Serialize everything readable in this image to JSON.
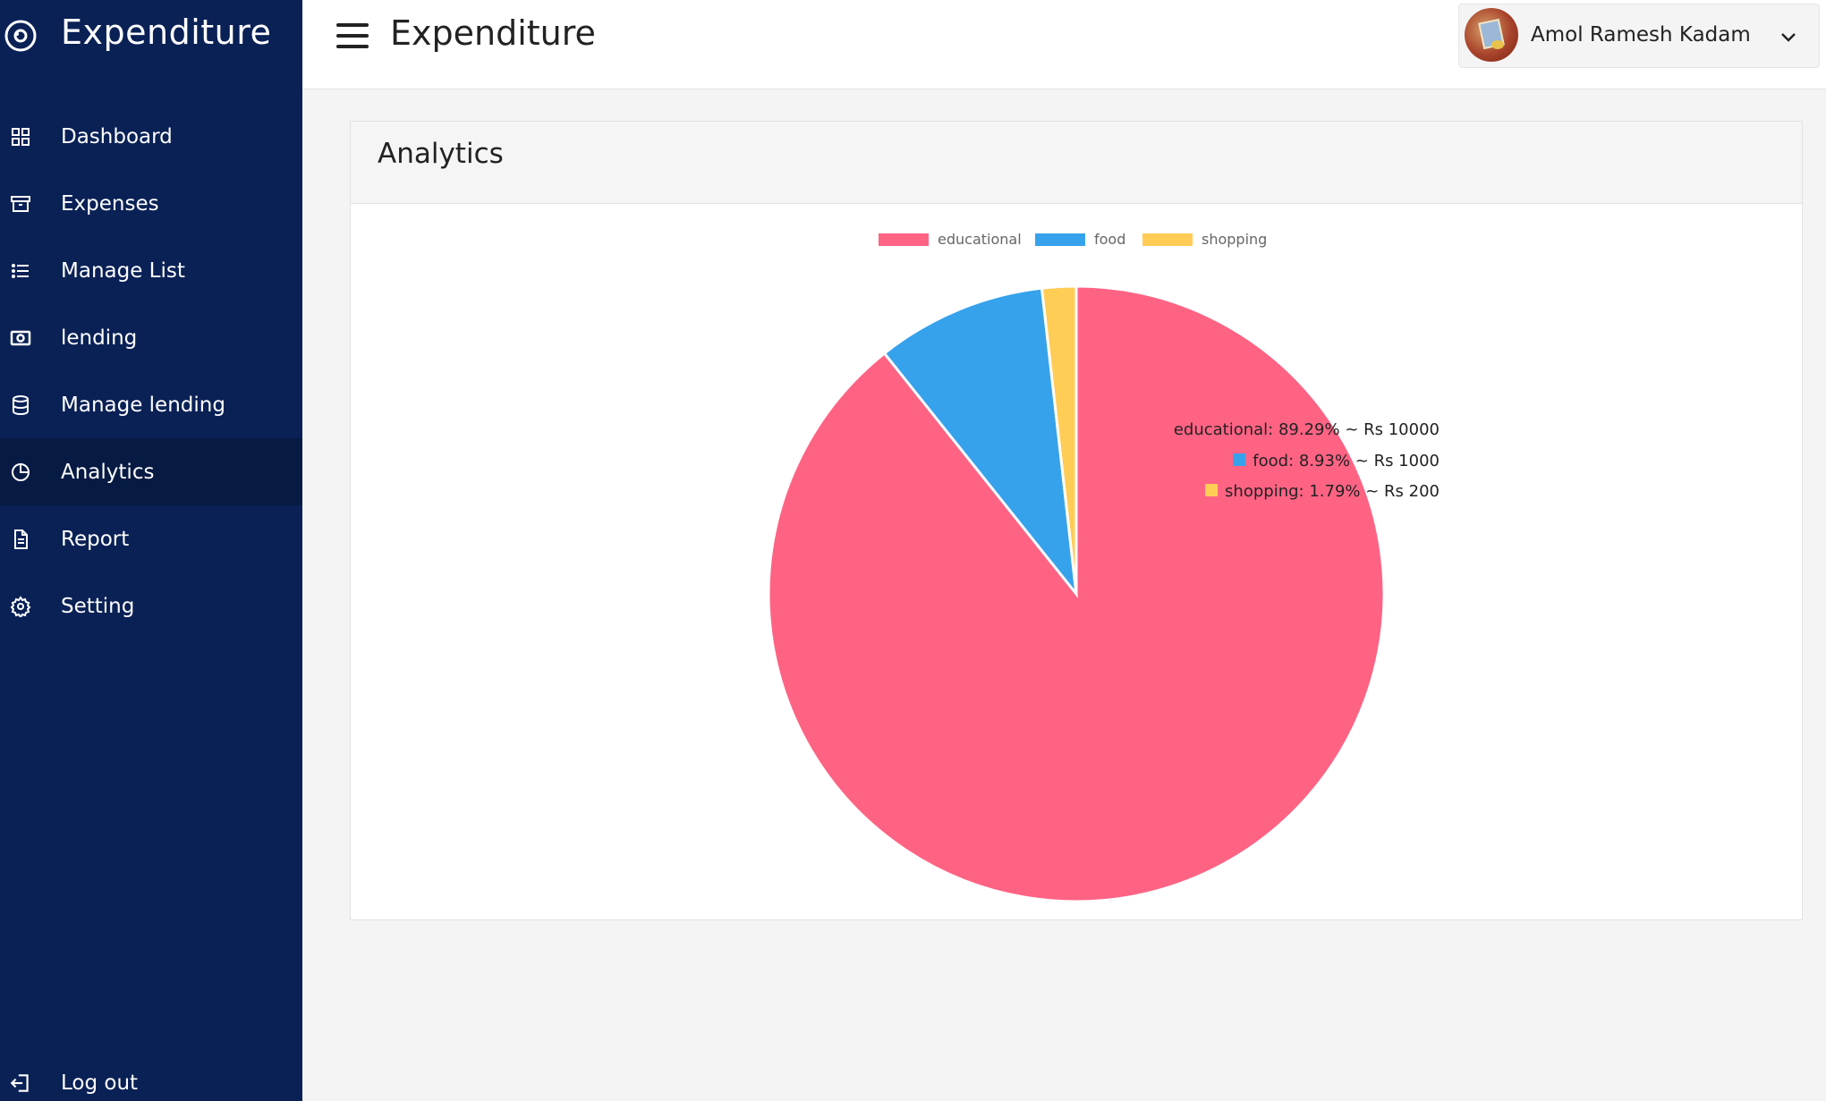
{
  "app": {
    "brand": "Expenditure"
  },
  "sidebar": {
    "items": [
      {
        "label": "Dashboard",
        "icon": "grid-icon"
      },
      {
        "label": "Expenses",
        "icon": "archive-icon"
      },
      {
        "label": "Manage List",
        "icon": "list-icon"
      },
      {
        "label": "lending",
        "icon": "money-icon"
      },
      {
        "label": "Manage lending",
        "icon": "database-icon"
      },
      {
        "label": "Analytics",
        "icon": "pie-chart-icon",
        "active": true
      },
      {
        "label": "Report",
        "icon": "file-icon"
      },
      {
        "label": "Setting",
        "icon": "gear-icon"
      }
    ],
    "logout_label": "Log out"
  },
  "header": {
    "title": "Expenditure",
    "user_name": "Amol Ramesh Kadam"
  },
  "card": {
    "title": "Analytics"
  },
  "colors": {
    "sidebar": "#0a2156",
    "educational": "#ff6384",
    "food": "#36a2eb",
    "shopping": "#ffcd56"
  },
  "chart_data": {
    "type": "pie",
    "title": "",
    "categories": [
      "educational",
      "food",
      "shopping"
    ],
    "values": [
      10000,
      1000,
      200
    ],
    "colors": [
      "#ff6384",
      "#36a2eb",
      "#ffcd56"
    ],
    "legend_position": "top",
    "side_labels": [
      "educational: 89.29% ~ Rs 10000",
      "food: 8.93% ~ Rs 1000",
      "shopping: 1.79% ~ Rs 200"
    ]
  }
}
